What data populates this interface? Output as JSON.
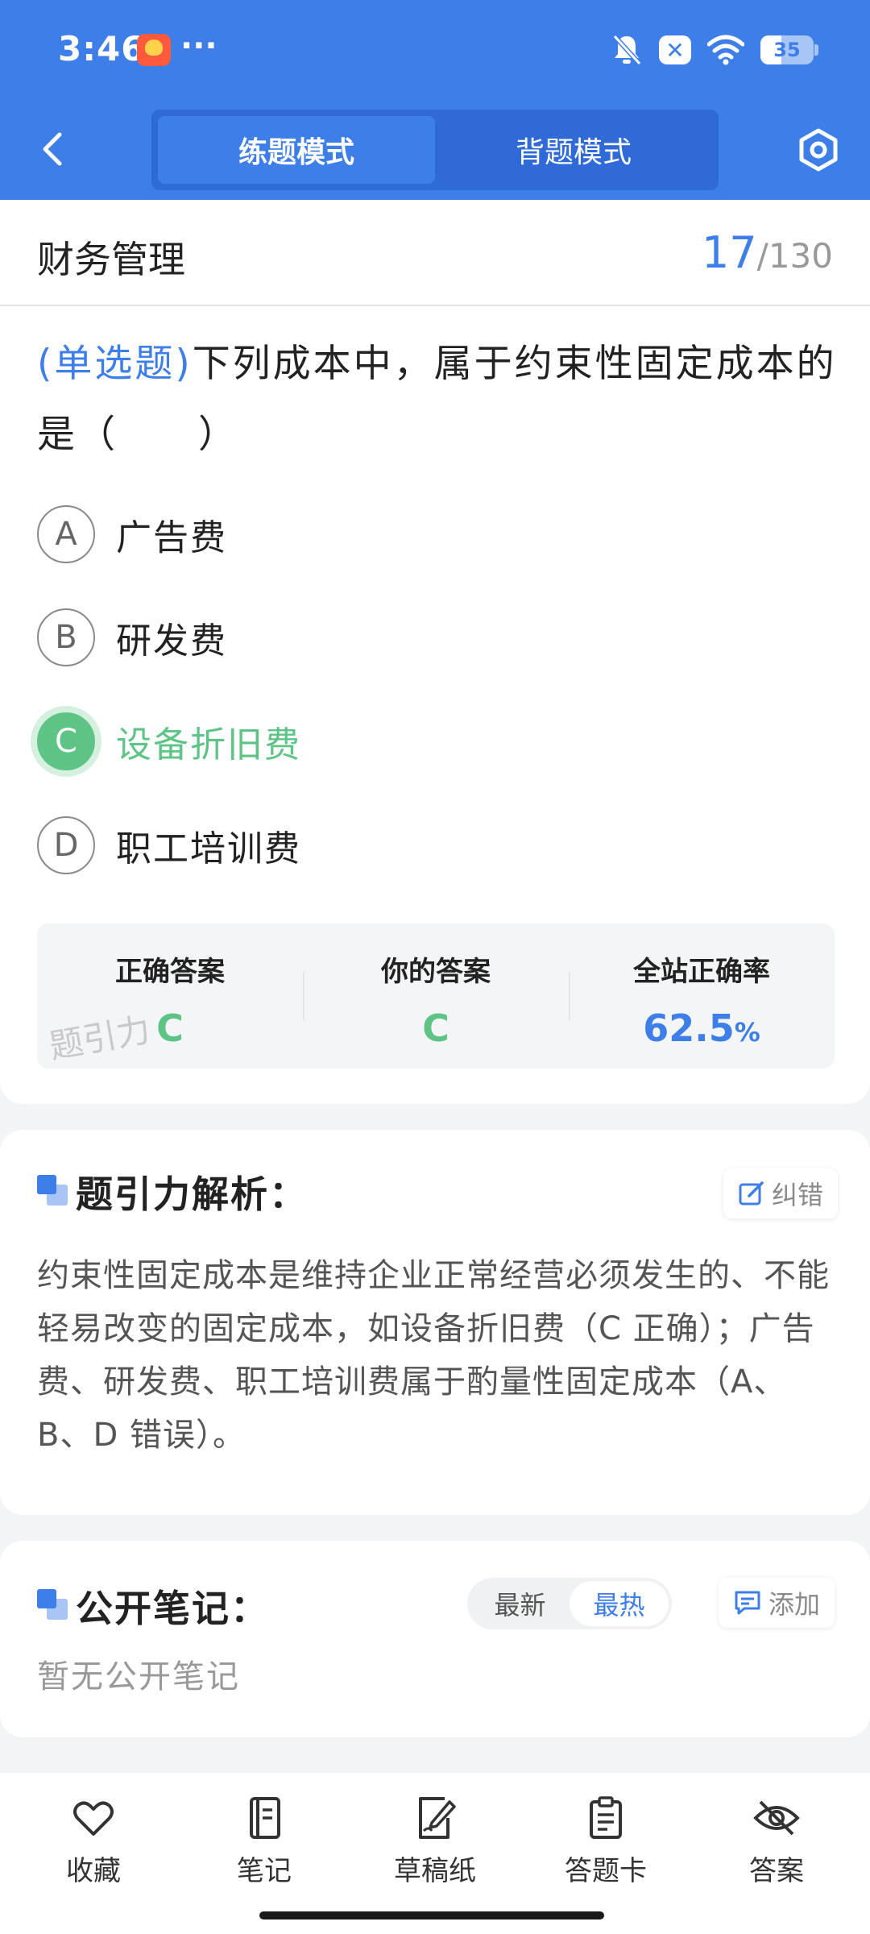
{
  "status_bar": {
    "time": "3:46",
    "dots": "···",
    "battery": "35",
    "x_label": "✕"
  },
  "header": {
    "tabs": [
      {
        "label": "练题模式",
        "active": true
      },
      {
        "label": "背题模式",
        "active": false
      }
    ]
  },
  "subject": {
    "title": "财务管理",
    "current": "17",
    "total": "/130"
  },
  "question": {
    "type": "(单选题)",
    "text": "下列成本中，属于约束性固定成本的是（　　）"
  },
  "options": [
    {
      "letter": "A",
      "text": "广告费",
      "state": "normal"
    },
    {
      "letter": "B",
      "text": "研发费",
      "state": "normal"
    },
    {
      "letter": "C",
      "text": "设备折旧费",
      "state": "correct"
    },
    {
      "letter": "D",
      "text": "职工培训费",
      "state": "normal"
    }
  ],
  "stats": {
    "correct_label": "正确答案",
    "correct_value": "C",
    "your_label": "你的答案",
    "your_value": "C",
    "rate_label": "全站正确率",
    "rate_value": "62.5",
    "rate_unit": "%",
    "watermark": "题引力"
  },
  "analysis": {
    "title": "题引力解析：",
    "report_label": "纠错",
    "text": "约束性固定成本是维持企业正常经营必须发生的、不能轻易改变的固定成本，如设备折旧费（C 正确）；广告费、研发费、职工培训费属于酌量性固定成本（A、B、D 错误）。"
  },
  "notes": {
    "title": "公开笔记：",
    "sort_latest": "最新",
    "sort_hot": "最热",
    "add_label": "添加",
    "empty": "暂无公开笔记"
  },
  "bottom_nav": [
    {
      "label": "收藏",
      "icon": "heart-icon"
    },
    {
      "label": "笔记",
      "icon": "notebook-icon"
    },
    {
      "label": "草稿纸",
      "icon": "draft-pen-icon"
    },
    {
      "label": "答题卡",
      "icon": "clipboard-icon"
    },
    {
      "label": "答案",
      "icon": "eye-off-icon"
    }
  ],
  "colors": {
    "primary": "#3d7ee8",
    "correct": "#5dc486"
  }
}
